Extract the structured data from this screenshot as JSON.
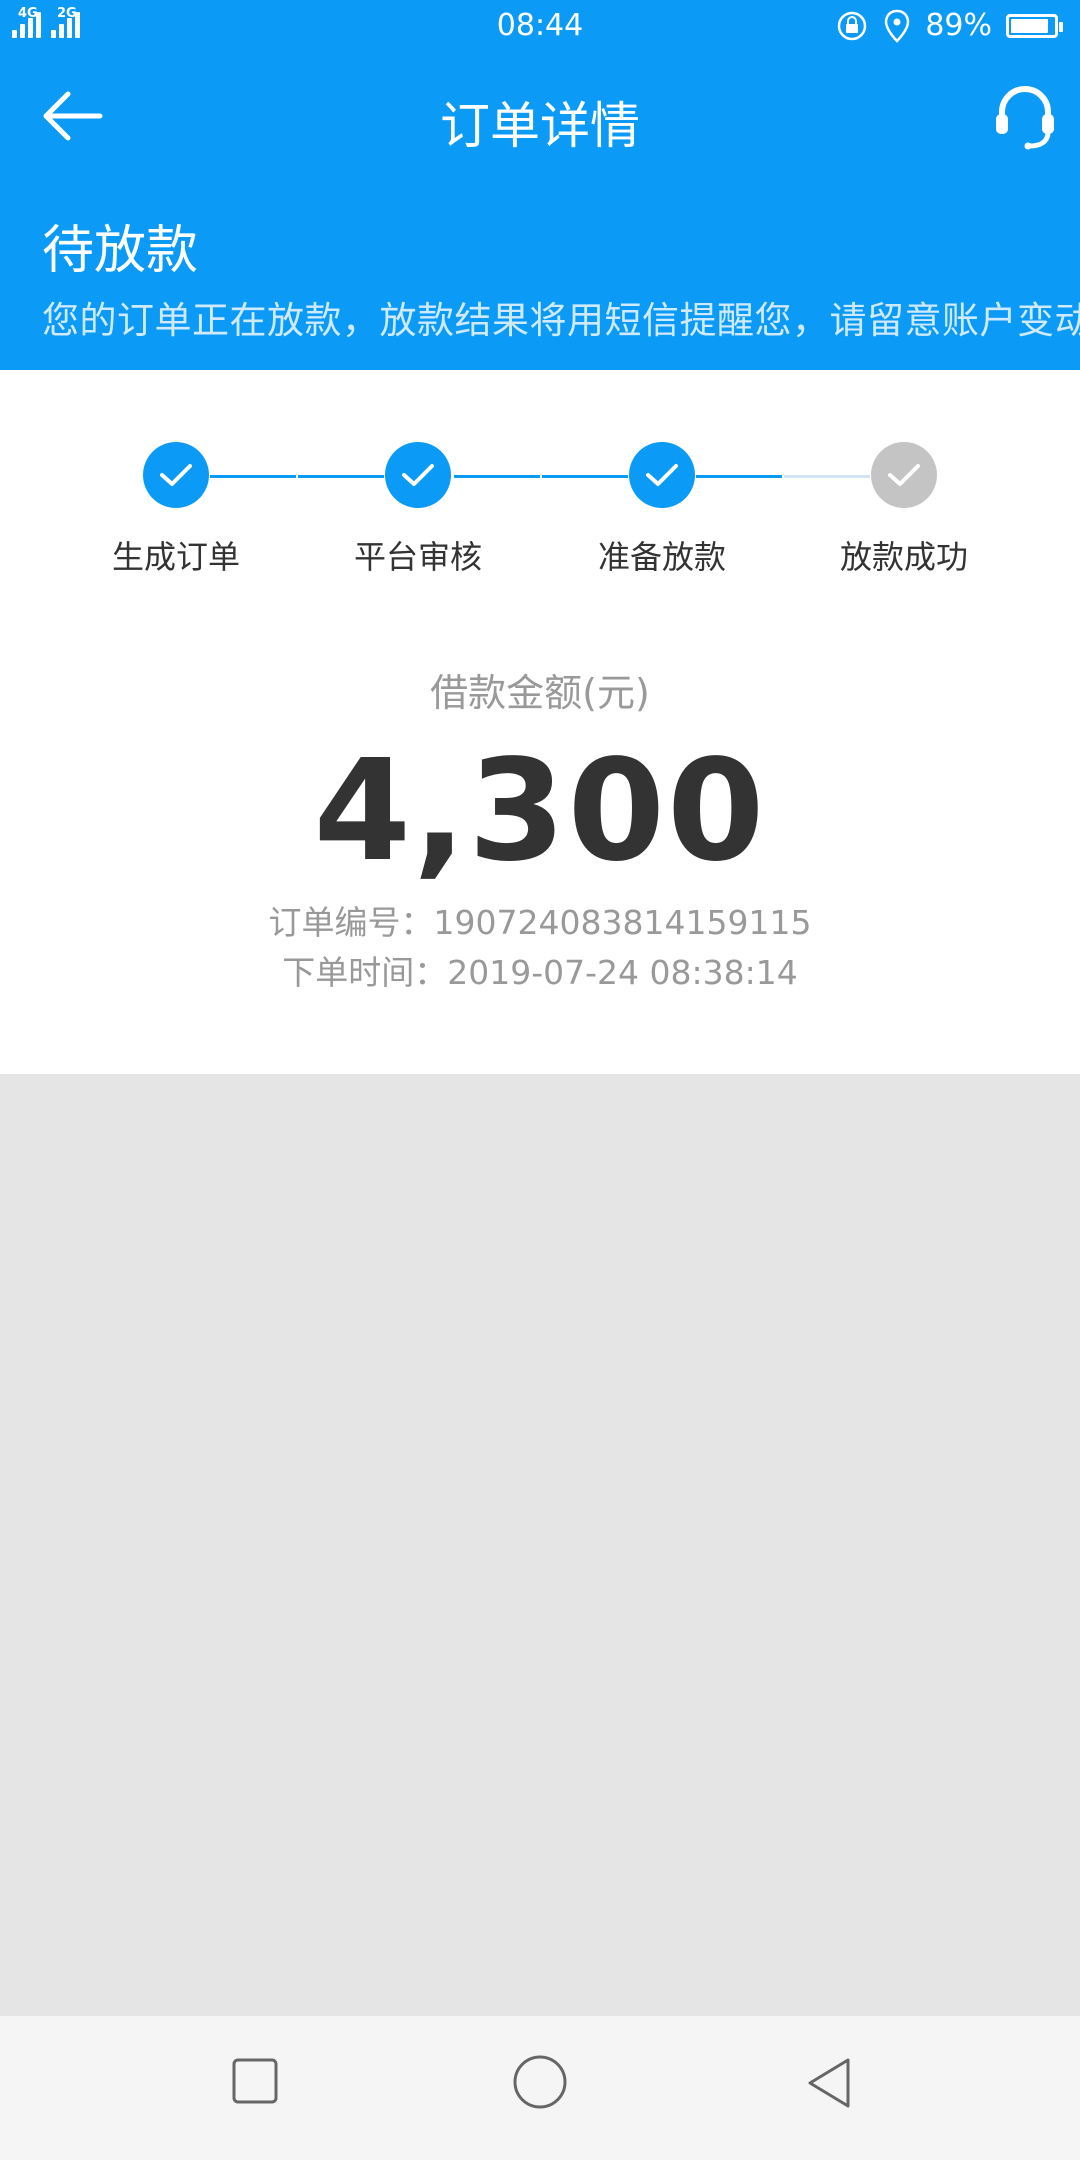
{
  "status_bar": {
    "network_1": "4G",
    "network_2": "2G",
    "time": "08:44",
    "battery_text": "89%",
    "battery_level": 0.89
  },
  "header": {
    "title": "订单详情",
    "back_icon": "arrow-left-icon",
    "support_icon": "headset-icon"
  },
  "order_status": {
    "title": "待放款",
    "description": "您的订单正在放款，放款结果将用短信提醒您，请留意账户变动"
  },
  "progress": {
    "steps": [
      {
        "label": "生成订单",
        "done": true
      },
      {
        "label": "平台审核",
        "done": true
      },
      {
        "label": "准备放款",
        "done": true
      },
      {
        "label": "放款成功",
        "done": false
      }
    ]
  },
  "loan": {
    "amount_label": "借款金额(元)",
    "amount": "4,300",
    "order_no_label": "订单编号：",
    "order_no": "190724083814159115",
    "order_time_label": "下单时间：",
    "order_time": "2019-07-24 08:38:14"
  },
  "colors": {
    "primary": "#0b9bf7",
    "pending_step": "#c4c4c4",
    "background": "#e5e5e5"
  },
  "system_nav": {
    "recent_icon": "square-icon",
    "home_icon": "circle-icon",
    "back_icon": "triangle-back-icon"
  }
}
